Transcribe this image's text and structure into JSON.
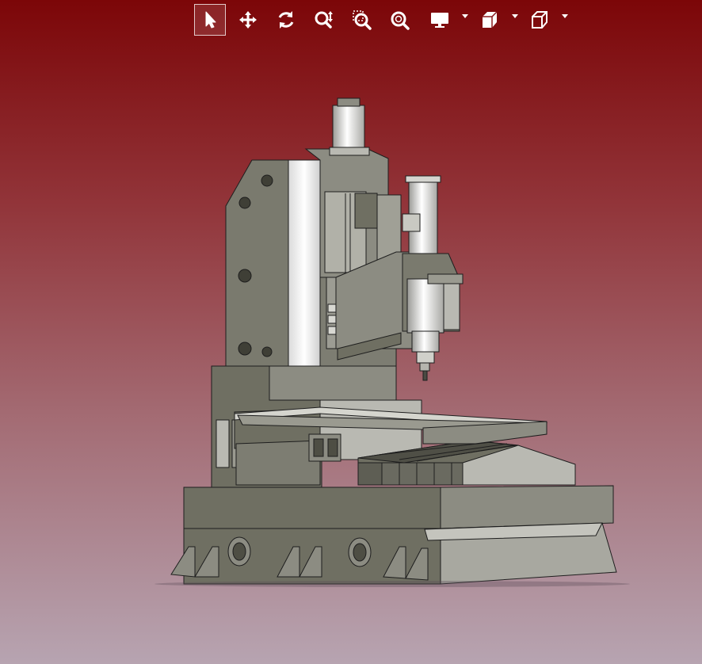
{
  "colors": {
    "bg_top": "#7c0608",
    "bg_bottom": "#b7a4b1",
    "toolbar_icon": "#ffffff",
    "machine_dark": "#6f6f62",
    "machine_mid": "#8c8c82",
    "machine_light": "#b9b9b2",
    "machine_white": "#f2f2f2",
    "outline": "#1e1e1e"
  },
  "toolbar": {
    "tools": [
      {
        "id": "select",
        "icon": "cursor-arrow-icon",
        "active": true
      },
      {
        "id": "pan",
        "icon": "move-arrows-icon",
        "active": false
      },
      {
        "id": "rotate",
        "icon": "rotate-icon",
        "active": false
      },
      {
        "id": "zoom",
        "icon": "zoom-icon",
        "active": false
      },
      {
        "id": "zoom-window",
        "icon": "zoom-window-icon",
        "active": false
      },
      {
        "id": "zoom-fit",
        "icon": "zoom-fit-icon",
        "active": false
      },
      {
        "id": "display-mode",
        "icon": "monitor-icon",
        "active": false,
        "dropdown": true
      },
      {
        "id": "render-mode",
        "icon": "shaded-cube-icon",
        "active": false,
        "dropdown": true
      },
      {
        "id": "view-orientation",
        "icon": "wireframe-cube-icon",
        "active": false,
        "dropdown": true
      }
    ]
  },
  "model": {
    "name_icon": "cnc-vertical-machining-center"
  }
}
